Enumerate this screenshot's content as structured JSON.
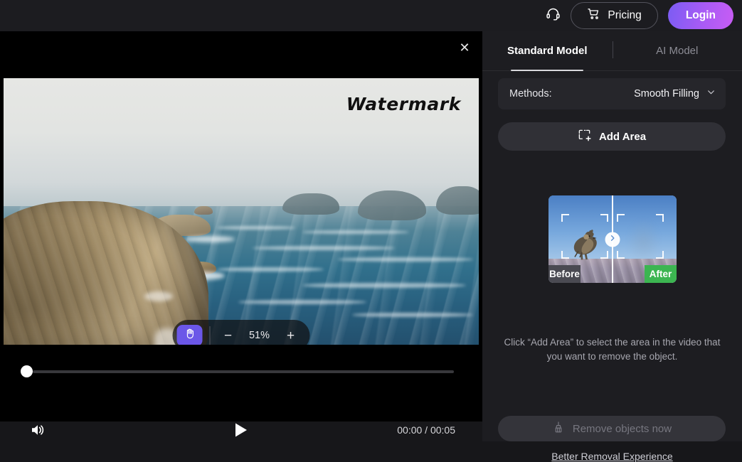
{
  "header": {
    "support_icon": "headset-icon",
    "pricing_label": "Pricing",
    "cart_icon": "shopping-cart-icon",
    "login_label": "Login",
    "login_gradient_from": "#7b5cf3",
    "login_gradient_to": "#c85cf3"
  },
  "video": {
    "close_icon": "✕",
    "watermark_text": "Watermark",
    "zoom": {
      "pan_icon": "hand-icon",
      "minus_label": "−",
      "plus_label": "+",
      "level": "51%"
    },
    "controls": {
      "volume_icon": "volume-icon",
      "play_icon": "play-icon",
      "time": "00:00 / 00:05",
      "current_time": "00:00",
      "duration": "00:05",
      "progress_percent": 0
    }
  },
  "panel": {
    "tabs": [
      {
        "label": "Standard Model",
        "active": true
      },
      {
        "label": "AI Model",
        "active": false
      }
    ],
    "methods": {
      "label": "Methods:",
      "value": "Smooth Filling",
      "chevron": "chevron-down-icon"
    },
    "add_area": {
      "label": "Add Area",
      "icon": "add-area-icon"
    },
    "preview": {
      "before_label": "Before",
      "after_label": "After",
      "handle_icon": "chevron-right-icon",
      "after_tag_color": "#3cb551",
      "before_tag_color": "#4a4a52"
    },
    "hint": "Click “Add Area” to select the area in the video that you want to remove the object.",
    "remove_button": {
      "label": "Remove objects now",
      "icon": "broom-icon",
      "disabled": true
    },
    "better_link": "Better Removal Experience"
  }
}
